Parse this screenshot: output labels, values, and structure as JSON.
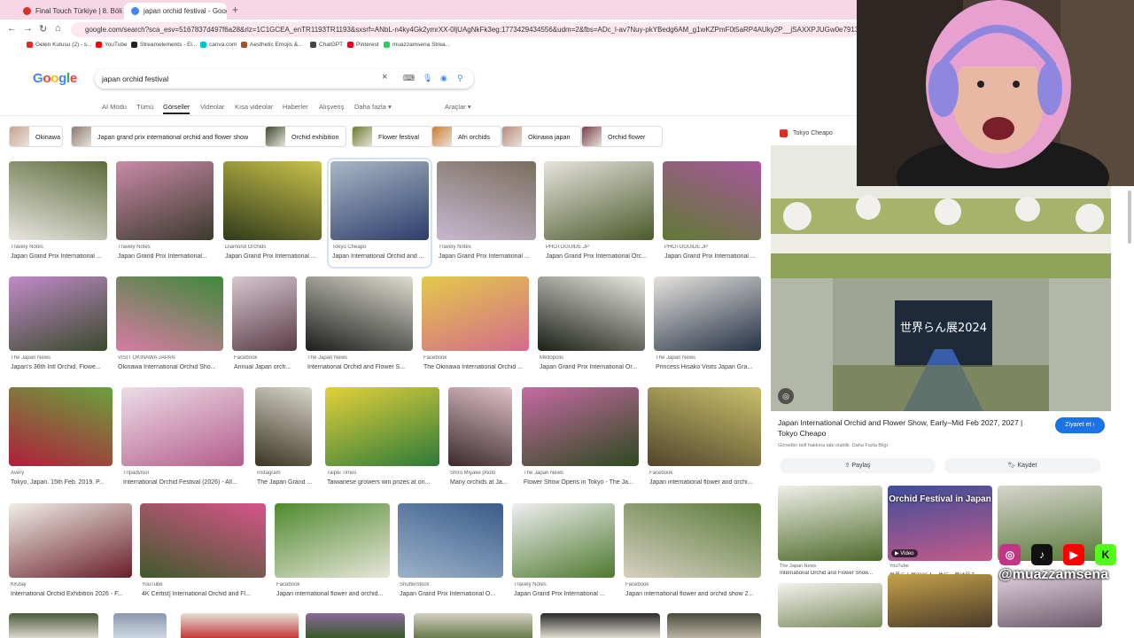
{
  "browser": {
    "tabs": [
      {
        "label": "Final Touch Türkiye | 8. Bölüm",
        "color": "#d93025"
      },
      {
        "label": "japan orchid festival - Google'd",
        "color": "#4285f4"
      }
    ],
    "url": "google.com/search?sca_esv=5167837d497f6a28&rlz=1C1GCEA_enTR1193TR1193&sxsrf=ANbL-n4ky4Gk2ymrXX-0ljUAgNkFk3eg:1773429434556&udm=2&fbs=ADc_l-av7Nuy-pkYBedg6AM_g1wKZPmF0t5aRP4AUky2P__jSAXXPJUGw0e79131bHRu5vWTbF2aoFlcUH8LO92vclatSGt",
    "bookmarks": [
      {
        "label": "Gelen Kutusu (2) - s...",
        "color": "#d93025"
      },
      {
        "label": "YouTube",
        "color": "#ff0000"
      },
      {
        "label": "Streamelements - El...",
        "color": "#222222"
      },
      {
        "label": "canva.com",
        "color": "#00c4cc"
      },
      {
        "label": "Aesthetic Emojis &...",
        "color": "#a0522d"
      },
      {
        "label": "ChatGPT",
        "color": "#444444"
      },
      {
        "label": "Pinterest",
        "color": "#e60023"
      },
      {
        "label": "muazzamsena Strea...",
        "color": "#2bd158"
      }
    ]
  },
  "google": {
    "logo": "Google",
    "query": "japan orchid festival",
    "nav": [
      "AI Modu",
      "Tümü",
      "Görseller",
      "Videolar",
      "Kısa videolar",
      "Haberler",
      "Alışveriş",
      "Daha fazla",
      "Araçlar"
    ],
    "chips": [
      {
        "label": "Okinawa",
        "color": "#c9a48f"
      },
      {
        "label": "Japan grand prix international orchid and flower show",
        "color": "#8a7a72"
      },
      {
        "label": "Orchid exhibition",
        "color": "#3e4b2e"
      },
      {
        "label": "Flower festival",
        "color": "#6b7b2c"
      },
      {
        "label": "Afri orchids",
        "color": "#cf7a2e"
      },
      {
        "label": "Okinawa japan",
        "color": "#b98a7a"
      },
      {
        "label": "Orchid flower",
        "color": "#7a3c4a"
      }
    ]
  },
  "images": [
    {
      "src": "Travely Notes",
      "title": "Japan Grand Prix International ...",
      "c1": "#5e6b3c",
      "c2": "#e8e6e0"
    },
    {
      "src": "Travely Notes",
      "title": "Japan Grand Prix International...",
      "c1": "#c98aa7",
      "c2": "#3b3a2e"
    },
    {
      "src": "Diamond Orchids",
      "title": "Japan Grand Prix International ...",
      "c1": "#c9c24a",
      "c2": "#2f3a1a"
    },
    {
      "src": "Tokyo Cheapo",
      "title": "Japan International Orchid and ...",
      "c1": "#a8b7c4",
      "c2": "#2c3d6b"
    },
    {
      "src": "Travely Notes",
      "title": "Japan Grand Prix International ...",
      "c1": "#7a6e5e",
      "c2": "#c7b8d0"
    },
    {
      "src": "PHOTOGUIDE.JP",
      "title": "Japan Grand Prix International Orc...",
      "c1": "#e6e3dc",
      "c2": "#4c5a2c"
    },
    {
      "src": "PHOTOGUIDE.JP",
      "title": "Japan Grand Prix International ...",
      "c1": "#a7569a",
      "c2": "#5f7a34"
    },
    {
      "src": "The Japan News",
      "title": "Japan's 36th Intl Orchid, Flowe...",
      "c1": "#c08ac9",
      "c2": "#3a4a2c"
    },
    {
      "src": "VISIT OKINAWA JAPAN",
      "title": "Okinawa International Orchid Sho...",
      "c1": "#3f8a3a",
      "c2": "#d97aa5"
    },
    {
      "src": "Facebook",
      "title": "Annual Japan orch...",
      "c1": "#d6c7cf",
      "c2": "#5b3c47"
    },
    {
      "src": "The Japan News",
      "title": "International Orchid and Flower S...",
      "c1": "#dcdcd0",
      "c2": "#1d1d1d"
    },
    {
      "src": "Facebook",
      "title": "The Okinawa International Orchid ...",
      "c1": "#e3c94a",
      "c2": "#d46b8c"
    },
    {
      "src": "Meltopolis",
      "title": "Japan Grand Prix International Or...",
      "c1": "#e8e8e0",
      "c2": "#1b1f18"
    },
    {
      "src": "The Japan News",
      "title": "Princess Hisako Visits Japan Gra...",
      "c1": "#e5e2dd",
      "c2": "#263246"
    },
    {
      "src": "Avery",
      "title": "Tokyo, Japan. 15th Feb. 2019. P...",
      "c1": "#6aa23c",
      "c2": "#b01f3c"
    },
    {
      "src": "Tripadvisor",
      "title": "International Orchid Festival (2026) - All...",
      "c1": "#ecdde6",
      "c2": "#b45d8c"
    },
    {
      "src": "Instagram",
      "title": "The Japan Grand ...",
      "c1": "#d8d6c8",
      "c2": "#3a3524"
    },
    {
      "src": "Taipei Times",
      "title": "Taiwanese growers win prizes at on...",
      "c1": "#e3d13a",
      "c2": "#2d7a3a"
    },
    {
      "src": "Shiro Miyake photo",
      "title": "Many orchids at Ja...",
      "c1": "#dfc1c9",
      "c2": "#3b2a2c"
    },
    {
      "src": "The Japan News",
      "title": "Flower Show Opens in Tokyo - The Ja...",
      "c1": "#c66aa3",
      "c2": "#2d4a1f"
    },
    {
      "src": "Facebook",
      "title": "Japan international flower and orchi...",
      "c1": "#c9c06a",
      "c2": "#53452c"
    },
    {
      "src": "KKday",
      "title": "International Orchid Exhibition 2026 - F...",
      "c1": "#f0eee8",
      "c2": "#6a1f2a"
    },
    {
      "src": "YouTube",
      "title": "4K Certist] International Orchid and Fl...",
      "c1": "#d9548b",
      "c2": "#3f5a2a"
    },
    {
      "src": "Facebook",
      "title": "Japan international flower and orchid...",
      "c1": "#4f8a2f",
      "c2": "#e8e6d8"
    },
    {
      "src": "Shutterstock",
      "title": "Japan Grand Prix International O...",
      "c1": "#3b5b8a",
      "c2": "#9bb3c9"
    },
    {
      "src": "Travely Notes",
      "title": "Japan Grand Prix International ...",
      "c1": "#f0eef0",
      "c2": "#4d7a2e"
    },
    {
      "src": "Facebook",
      "title": "Japan international flower and orchid show 2...",
      "c1": "#5a7a3a",
      "c2": "#d6d0c0"
    }
  ],
  "bottom_row": [
    {
      "c1": "#4a5a38",
      "c2": "#dcd7d0"
    },
    {
      "c1": "#8a9ab0",
      "c2": "#cfd6e0"
    },
    {
      "c1": "#e6e0d6",
      "c2": "#c43a3a"
    },
    {
      "c1": "#8a6a9a",
      "c2": "#3a5a2a"
    },
    {
      "c1": "#d4d0c4",
      "c2": "#6a7a4a"
    },
    {
      "c1": "#2a2a2a",
      "c2": "#e0dcd0"
    },
    {
      "c1": "#4a4a3a",
      "c2": "#bcb4a4"
    }
  ],
  "preview": {
    "source": "Tokyo Cheapo",
    "title": "Japan International Orchid and Flower Show, Early–Mid Feb 2027, 2027 | Tokyo Cheapo",
    "visit_label": "Ziyaret et",
    "note": "Görseller telif hakkına tabi olabilir. Daha Fazla Bilgi",
    "share_label": "Paylaş",
    "save_label": "Kaydet",
    "sign_text": "世界らん展2024",
    "related": [
      {
        "src": "The Japan News",
        "title": "International Orchid and Flower Show...",
        "c1": "#f0efe8",
        "c2": "#4d6a2a",
        "overlay": ""
      },
      {
        "src": "YouTube",
        "title": "世界らん展2026★一生に一度は見る...",
        "c1": "#3e4e9a",
        "c2": "#c45a8a",
        "overlay": "Orchid Festival in Japan"
      },
      {
        "src": "",
        "title": "",
        "c1": "#d6d4cc",
        "c2": "#5a7a3a",
        "overlay": ""
      },
      {
        "src": "",
        "title": "",
        "c1": "#f4f2ee",
        "c2": "#7a8a5a",
        "overlay": ""
      },
      {
        "src": "",
        "title": "",
        "c1": "#c4a24a",
        "c2": "#4a3a2a",
        "overlay": ""
      },
      {
        "src": "",
        "title": "",
        "c1": "#e0d0dc",
        "c2": "#6a5a6a",
        "overlay": ""
      }
    ],
    "video_label": "Video"
  },
  "overlay": {
    "handle": "@muazzamsena",
    "social": [
      {
        "name": "instagram-icon",
        "glyph": "◎",
        "color": "#c13584"
      },
      {
        "name": "tiktok-icon",
        "glyph": "♪",
        "color": "#111111"
      },
      {
        "name": "youtube-icon",
        "glyph": "▶",
        "color": "#ff0000"
      },
      {
        "name": "kick-icon",
        "glyph": "K",
        "color": "#53fc18"
      }
    ]
  }
}
